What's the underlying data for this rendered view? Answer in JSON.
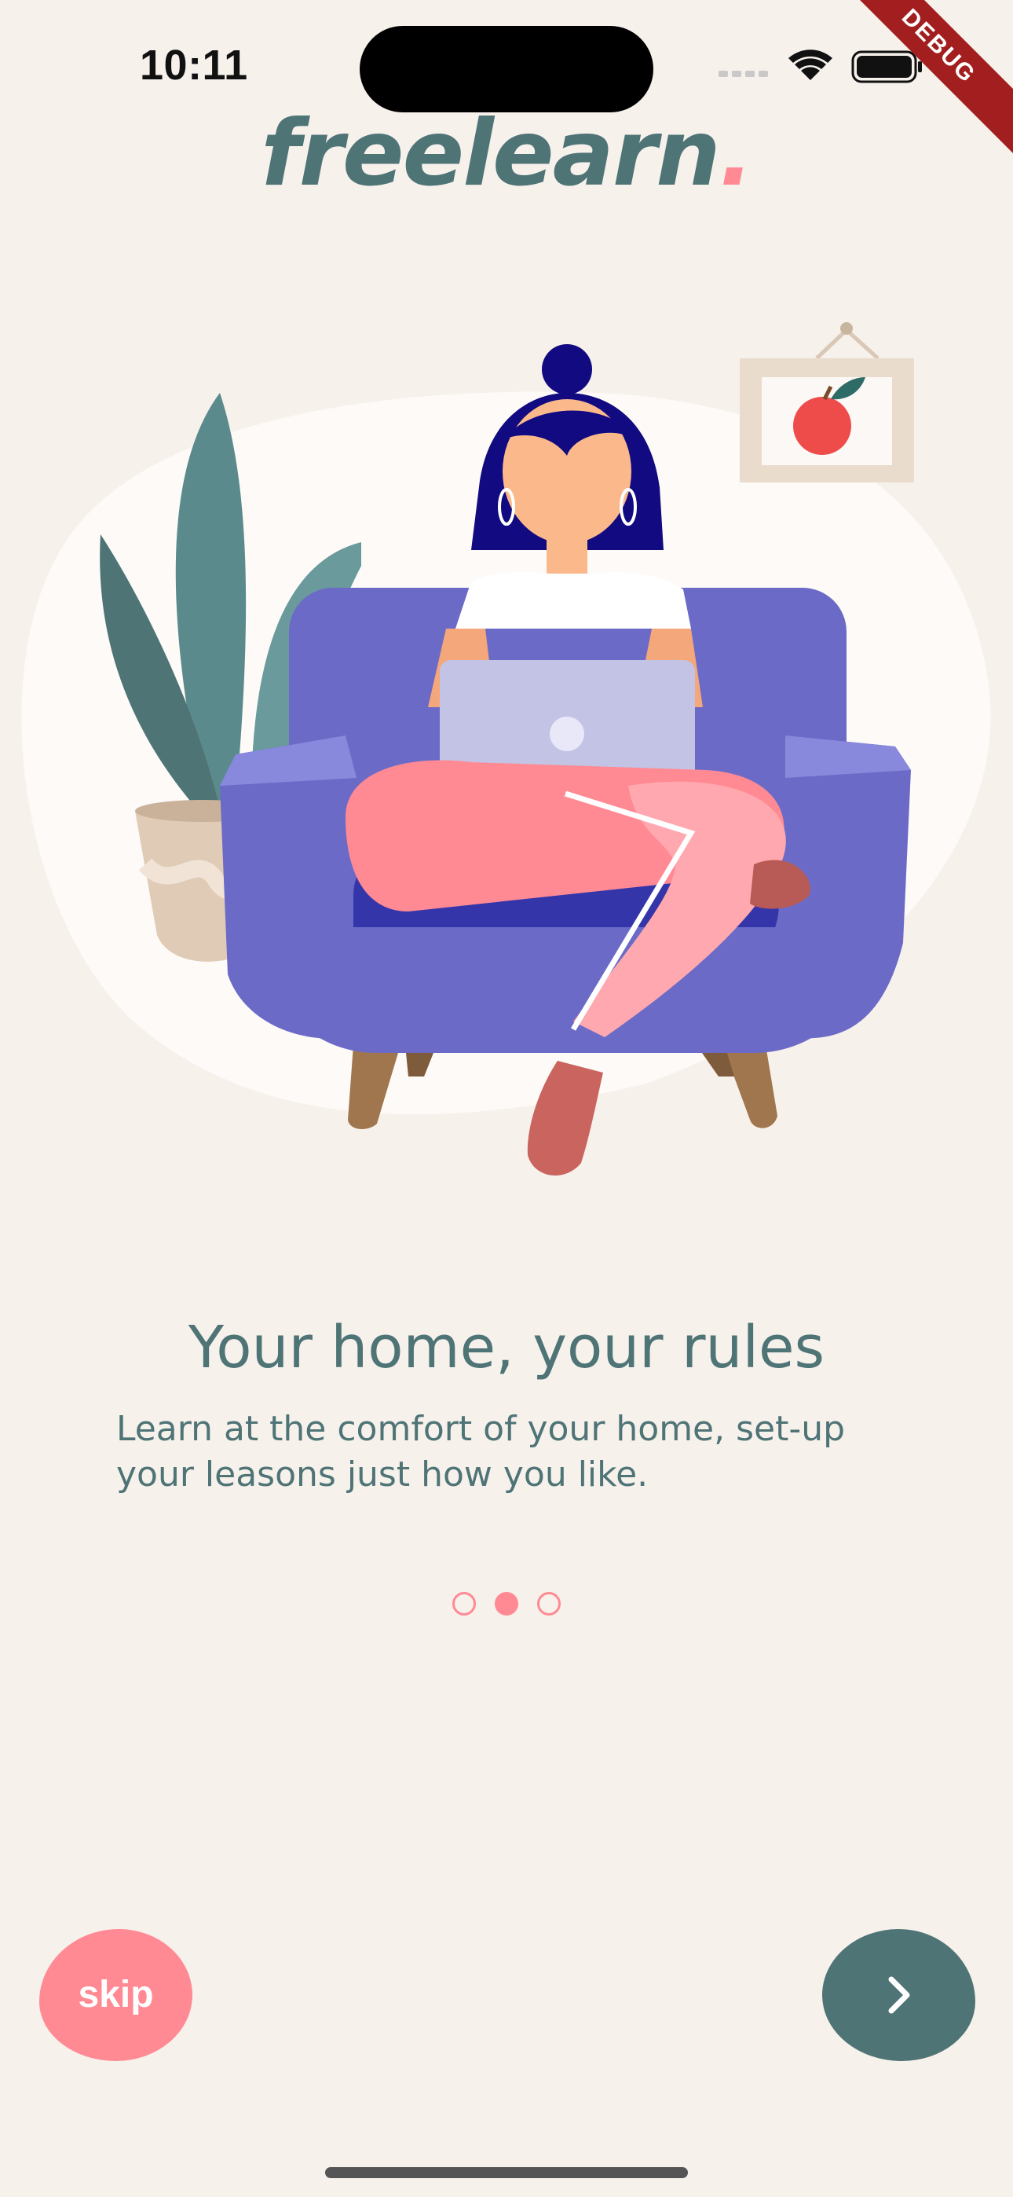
{
  "status_bar": {
    "time": "10:11",
    "icons": [
      "signal-icon",
      "wifi-icon",
      "battery-icon"
    ]
  },
  "debug_banner": "DEBUG",
  "logo": {
    "text": "freelearn",
    "dot": "."
  },
  "onboarding": {
    "title": "Your home, your rules",
    "description": "Learn at the comfort of your home, set-up your leasons just how you like.",
    "page_count": 3,
    "current_page": 2
  },
  "actions": {
    "skip_label": "skip",
    "next_icon": "chevron-right-icon"
  },
  "colors": {
    "background": "#F7F1EC",
    "primary": "#4F7476",
    "accent": "#FF8A93"
  }
}
